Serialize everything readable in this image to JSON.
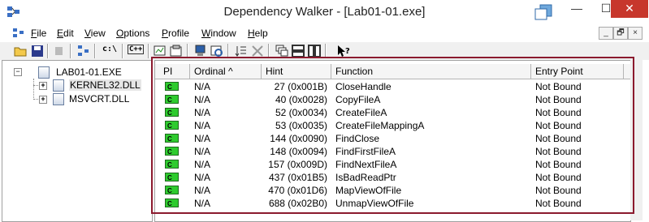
{
  "window": {
    "title": "Dependency Walker - [Lab01-01.exe]",
    "controls": {
      "minimize": "—",
      "maximize": "☐",
      "close": "✕"
    }
  },
  "menu": [
    {
      "label": "File",
      "accel": "F",
      "rest": "ile"
    },
    {
      "label": "Edit",
      "accel": "E",
      "rest": "dit"
    },
    {
      "label": "View",
      "accel": "V",
      "rest": "iew"
    },
    {
      "label": "Options",
      "accel": "O",
      "rest": "ptions"
    },
    {
      "label": "Profile",
      "accel": "P",
      "rest": "rofile"
    },
    {
      "label": "Window",
      "accel": "W",
      "rest": "indow"
    },
    {
      "label": "Help",
      "accel": "H",
      "rest": "elp"
    }
  ],
  "mdi_controls": {
    "minimize": "_",
    "restore": "🗗",
    "close": "×"
  },
  "toolbar": {
    "path_label": "c:\\",
    "cpp_label": "C++"
  },
  "tree": {
    "root": "LAB01-01.EXE",
    "children": [
      "KERNEL32.DLL",
      "MSVCRT.DLL"
    ],
    "expander": "+"
  },
  "list": {
    "columns": {
      "pi": "PI",
      "ordinal": "Ordinal ^",
      "hint": "Hint",
      "function": "Function",
      "entry": "Entry Point"
    },
    "badge": "C",
    "rows": [
      {
        "ordinal": "N/A",
        "hint": "27 (0x001B)",
        "function": "CloseHandle",
        "entry": "Not Bound"
      },
      {
        "ordinal": "N/A",
        "hint": "40 (0x0028)",
        "function": "CopyFileA",
        "entry": "Not Bound"
      },
      {
        "ordinal": "N/A",
        "hint": "52 (0x0034)",
        "function": "CreateFileA",
        "entry": "Not Bound"
      },
      {
        "ordinal": "N/A",
        "hint": "53 (0x0035)",
        "function": "CreateFileMappingA",
        "entry": "Not Bound"
      },
      {
        "ordinal": "N/A",
        "hint": "144 (0x0090)",
        "function": "FindClose",
        "entry": "Not Bound"
      },
      {
        "ordinal": "N/A",
        "hint": "148 (0x0094)",
        "function": "FindFirstFileA",
        "entry": "Not Bound"
      },
      {
        "ordinal": "N/A",
        "hint": "157 (0x009D)",
        "function": "FindNextFileA",
        "entry": "Not Bound"
      },
      {
        "ordinal": "N/A",
        "hint": "437 (0x01B5)",
        "function": "IsBadReadPtr",
        "entry": "Not Bound"
      },
      {
        "ordinal": "N/A",
        "hint": "470 (0x01D6)",
        "function": "MapViewOfFile",
        "entry": "Not Bound"
      },
      {
        "ordinal": "N/A",
        "hint": "688 (0x02B0)",
        "function": "UnmapViewOfFile",
        "entry": "Not Bound"
      }
    ]
  },
  "colors": {
    "highlight": "#8b1a2e",
    "close_button": "#c7372c",
    "badge_green": "#2ecb2e"
  }
}
